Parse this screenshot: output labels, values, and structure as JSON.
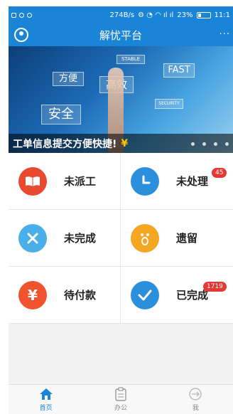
{
  "status_bar": {
    "speed": "274B/s",
    "battery_pct": "23%",
    "time": "11:1"
  },
  "header": {
    "title": "解忧平台",
    "more": "···"
  },
  "banner": {
    "tiles": [
      "STABLE",
      "FAST",
      "方便",
      "高效",
      "SECURITY",
      "安全"
    ],
    "caption": "工单信息提交方便快捷!",
    "caption_symbol": "¥",
    "dot_count": 4
  },
  "grid": [
    {
      "label": "未派工",
      "icon": "book-icon",
      "color": "#e84a2f",
      "badge": ""
    },
    {
      "label": "未处理",
      "icon": "clock-icon",
      "color": "#2b8fdc",
      "badge": "45"
    },
    {
      "label": "未完成",
      "icon": "close-icon",
      "color": "#4aaee8",
      "badge": ""
    },
    {
      "label": "遗留",
      "icon": "face-icon",
      "color": "#f5a623",
      "badge": ""
    },
    {
      "label": "待付款",
      "icon": "yen-icon",
      "color": "#f2532f",
      "badge": ""
    },
    {
      "label": "已完成",
      "icon": "check-icon",
      "color": "#2b8fdc",
      "badge": "1719"
    }
  ],
  "tabs": [
    {
      "label": "首页",
      "icon": "home-icon",
      "active": true
    },
    {
      "label": "办公",
      "icon": "clipboard-icon",
      "active": false
    },
    {
      "label": "我",
      "icon": "profile-icon",
      "active": false
    }
  ],
  "colors": {
    "brand": "#1a84d6",
    "badge": "#e53935"
  }
}
